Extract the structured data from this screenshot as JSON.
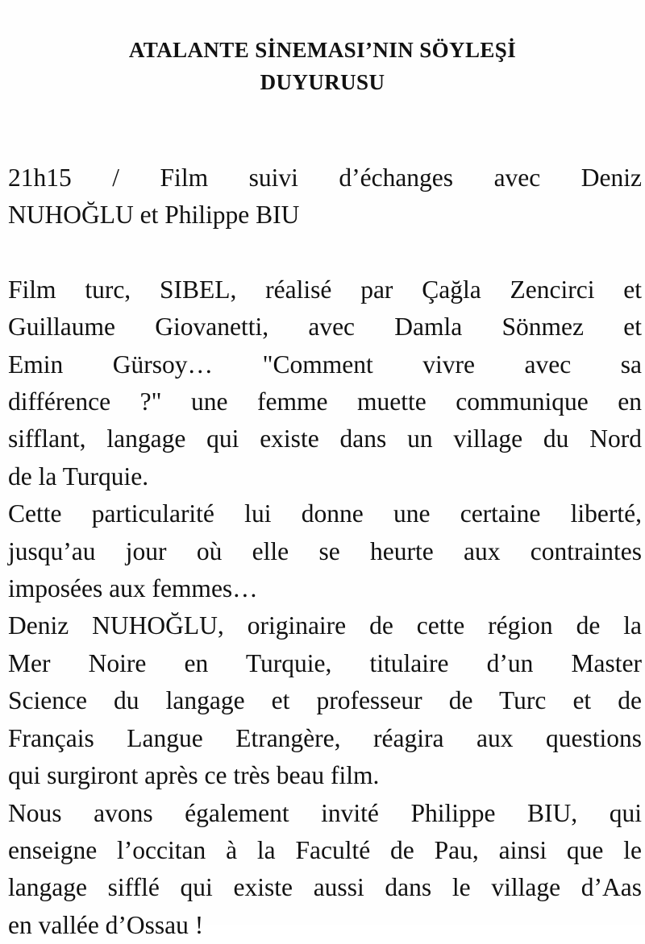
{
  "title": {
    "line1": "ATALANTE SİNEMASI’NIN SÖYLEŞİ",
    "line2": "DUYURUSU"
  },
  "paragraphs": [
    {
      "lines": [
        "21h15 / Film suivi d’échanges avec Deniz",
        "NUHOĞLU et Philippe BIU"
      ]
    },
    {
      "lines": [
        "Film turc, SIBEL, réalisé par Çağla Zencirci et",
        "Guillaume Giovanetti, avec Damla Sönmez et",
        "Emin Gürsoy… \"Comment vivre avec sa",
        "différence ?\" une femme muette communique en",
        "sifflant, langage qui existe dans un village du Nord",
        "de la Turquie."
      ]
    },
    {
      "lines": [
        "Cette particularité lui donne une certaine liberté,",
        "jusqu’au jour où elle se heurte aux contraintes",
        "imposées aux femmes…"
      ]
    },
    {
      "lines": [
        "Deniz NUHOĞLU, originaire de cette région de la",
        "Mer Noire en Turquie, titulaire d’un Master",
        "Science du langage et professeur de Turc et de",
        "Français Langue Etrangère, réagira aux questions",
        "qui surgiront après ce très beau film."
      ]
    },
    {
      "lines": [
        "Nous avons également invité Philippe BIU, qui",
        "enseigne l’occitan à la Faculté de Pau, ainsi que le",
        "langage sifflé qui existe aussi dans le village d’Aas",
        "en vallée d’Ossau !"
      ]
    }
  ]
}
